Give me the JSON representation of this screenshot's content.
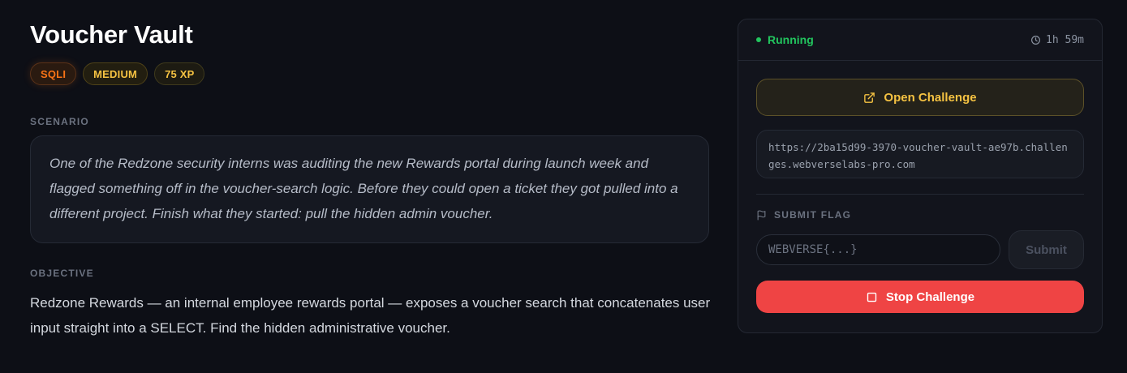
{
  "challenge": {
    "title": "Voucher Vault",
    "badges": {
      "category": "SQLI",
      "difficulty": "MEDIUM",
      "xp": "75 XP"
    },
    "scenario_label": "SCENARIO",
    "scenario_text": "One of the Redzone security interns was auditing the new Rewards portal during launch week and flagged something off in the voucher-search logic. Before they could open a ticket they got pulled into a different project. Finish what they started: pull the hidden admin voucher.",
    "objective_label": "OBJECTIVE",
    "objective_text": "Redzone Rewards — an internal employee rewards portal — exposes a voucher search that concatenates user input straight into a SELECT. Find the hidden administrative voucher."
  },
  "panel": {
    "status": "Running",
    "timer": "1h 59m",
    "open_button": "Open Challenge",
    "url": "https://2ba15d99-3970-voucher-vault-ae97b.challenges.webverselabs-pro.com",
    "flag_label": "SUBMIT FLAG",
    "flag_placeholder": "WEBVERSE{...}",
    "submit_button": "Submit",
    "stop_button": "Stop Challenge"
  },
  "colors": {
    "background": "#0d0f16",
    "accent_gold": "#f5c242",
    "category_orange": "#f97316",
    "status_green": "#22c55e",
    "stop_red": "#ef4444"
  },
  "icons": {
    "status": "status-dot-icon",
    "timer": "clock-icon",
    "open": "external-link-icon",
    "flag": "flag-icon",
    "stop": "stop-square-icon"
  }
}
